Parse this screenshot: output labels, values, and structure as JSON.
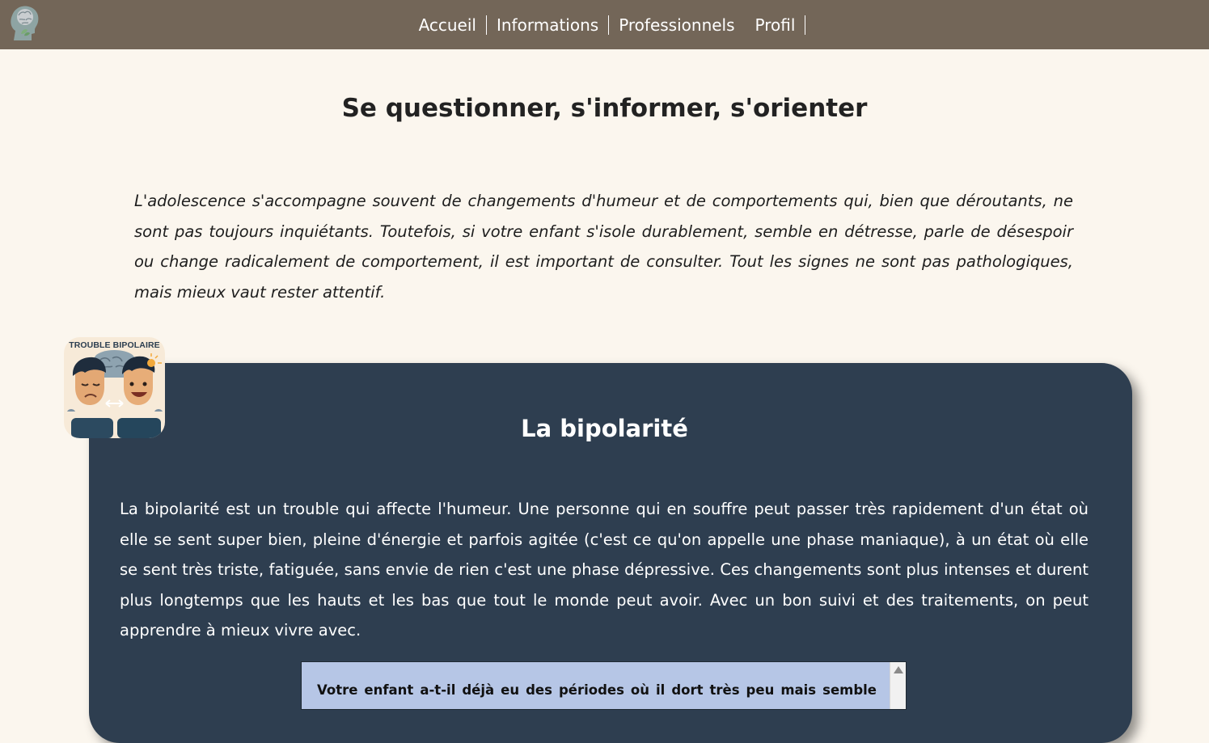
{
  "nav": {
    "items": [
      {
        "label": "Accueil"
      },
      {
        "label": "Informations"
      },
      {
        "label": "Professionnels"
      },
      {
        "label": "Profil"
      }
    ],
    "logo_icon": "brain-head-icon"
  },
  "page": {
    "title": "Se questionner, s'informer, s'orienter",
    "intro": "L'adolescence s'accompagne souvent de changements d'humeur et de comportements qui, bien que déroutants, ne sont pas toujours inquiétants. Toutefois, si votre enfant s'isole durablement, semble en détresse, parle de désespoir ou change radicalement de comportement, il est important de consulter. Tout les signes ne sont pas pathologiques, mais mieux vaut rester attentif."
  },
  "card": {
    "image_label": "TROUBLE BIPOLAIRE",
    "title": "La bipolarité",
    "text": "La bipolarité est un trouble qui affecte l'humeur. Une personne qui en souffre peut passer très rapidement d'un état où elle se sent super bien, pleine d'énergie et parfois agitée (c'est ce qu'on appelle une phase maniaque), à un état où elle se sent très triste, fatiguée, sans envie de rien c'est une phase dépressive. Ces changements sont plus intenses et durent plus longtemps que les hauts et les bas que tout le monde peut avoir. Avec un bon suivi et des traitements, on peut apprendre à mieux vivre avec.",
    "question": "Votre enfant a-t-il déjà eu des périodes où il dort très peu mais semble"
  },
  "colors": {
    "topbar": "#736658",
    "page_background": "#fbf6ee",
    "card_background": "#2e3e50",
    "question_background": "#b6c6e6"
  }
}
